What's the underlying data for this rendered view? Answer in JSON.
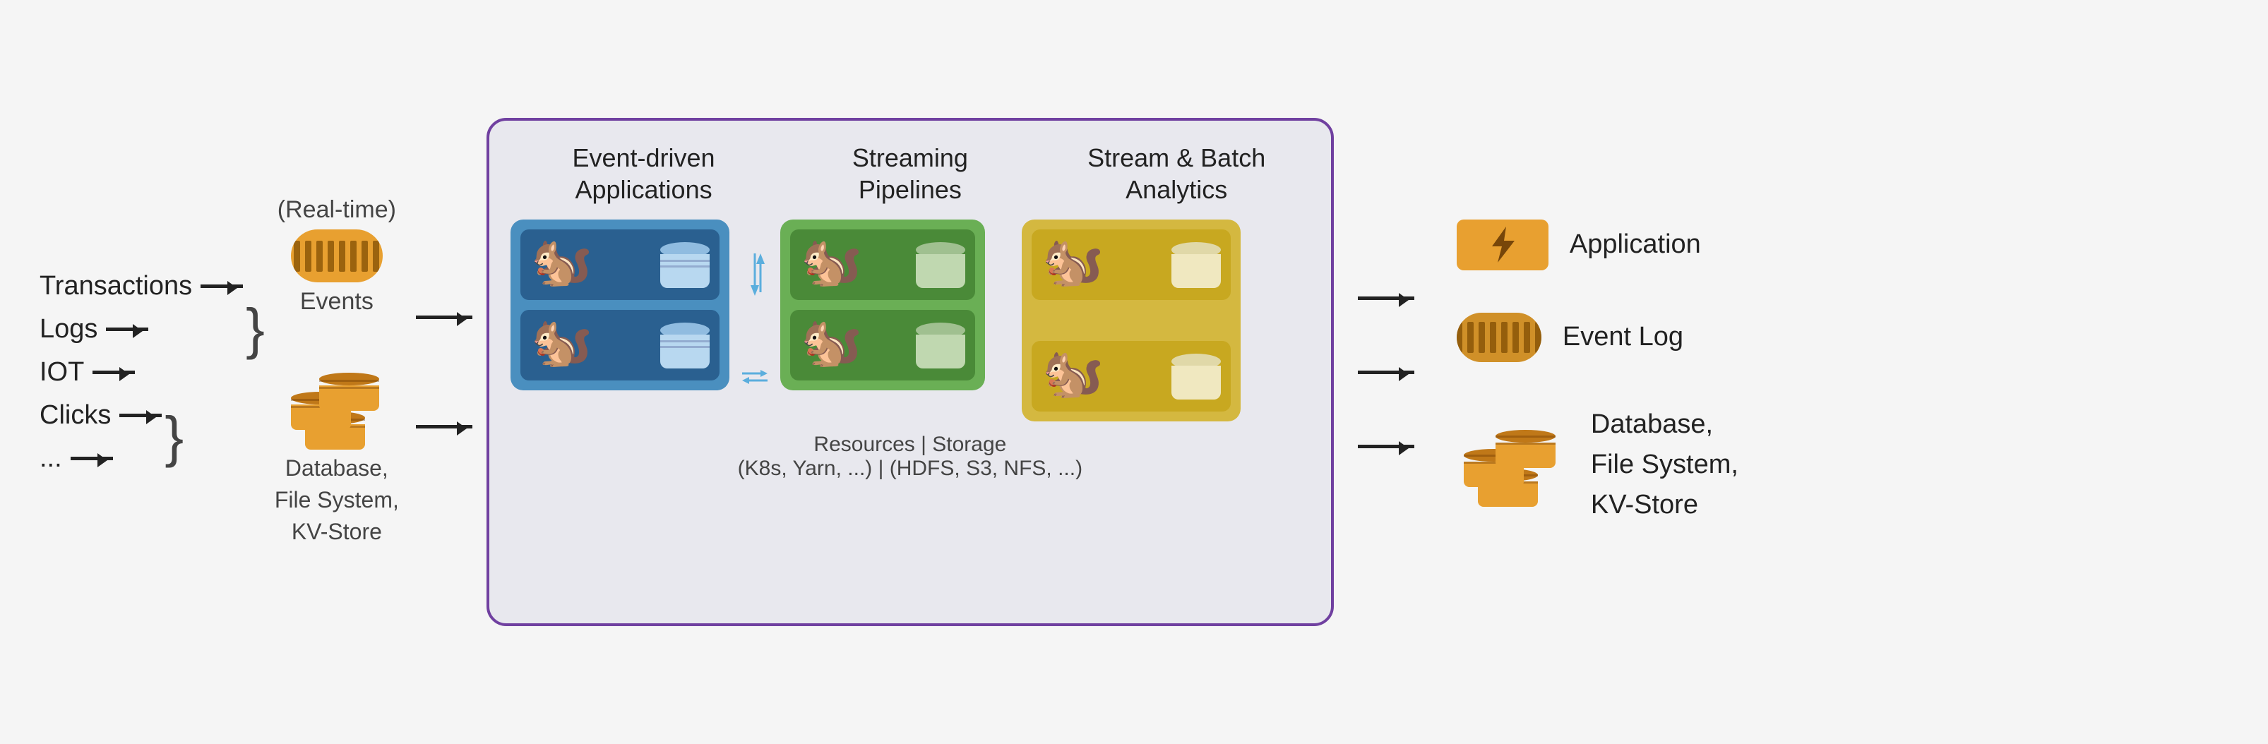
{
  "header": {
    "col1": "Event-driven\nApplications",
    "col2": "Streaming\nPipelines",
    "col3": "Stream & Batch\nAnalytics"
  },
  "inputs": {
    "labels": [
      "Transactions",
      "Logs",
      "IOT",
      "Clicks",
      "..."
    ],
    "events_label": "(Real-time)",
    "events_sublabel": "Events",
    "db_label1": "Database,",
    "db_label2": "File System,",
    "db_label3": "KV-Store"
  },
  "resources": {
    "line1": "Resources | Storage",
    "line2": "(K8s, Yarn, ...) | (HDFS, S3, NFS, ...)"
  },
  "outputs": {
    "app_label": "Application",
    "eventlog_label": "Event Log",
    "db_label1": "Database,",
    "db_label2": "File System,",
    "db_label3": "KV-Store"
  },
  "colors": {
    "purple_border": "#7040a0",
    "blue_panel": "#4a8fbf",
    "green_panel": "#6aaf55",
    "yellow_panel": "#d4b840",
    "orange": "#e8a030",
    "dark_orange": "#c07818"
  }
}
